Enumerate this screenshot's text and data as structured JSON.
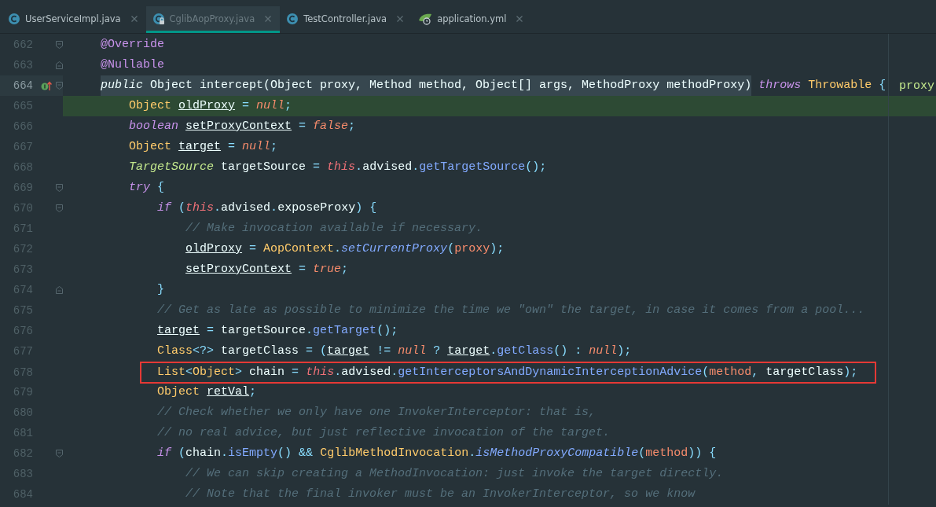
{
  "tabs": [
    {
      "label": "UserServiceImpl.java",
      "kind": "class",
      "selected": false,
      "locked": false
    },
    {
      "label": "CglibAopProxy.java",
      "kind": "class",
      "selected": true,
      "locked": true
    },
    {
      "label": "TestController.java",
      "kind": "class",
      "selected": false,
      "locked": false
    },
    {
      "label": "application.yml",
      "kind": "config",
      "selected": false,
      "locked": false
    }
  ],
  "lines": [
    {
      "number": "662",
      "fold_start": true,
      "tokens": [
        {
          "text": "    @Override",
          "kind": "annotation"
        }
      ]
    },
    {
      "number": "663",
      "fold_end": true,
      "tokens": [
        {
          "text": "    @Nullable",
          "kind": "annotation"
        }
      ]
    },
    {
      "number": "664",
      "fold_start": true,
      "current": true,
      "implements_marker": true,
      "inline_value": "proxy",
      "tokens": [
        {
          "text": "    public",
          "kind": "keyword",
          "selected": true
        },
        {
          "text": " Object intercept(Object proxy, Method method, Object[] args, MethodProxy methodProxy)",
          "selected": true
        },
        {
          "text": " throws",
          "kind": "keyword"
        },
        {
          "text": " Throwable",
          "kind": "type"
        },
        {
          "text": " {",
          "kind": "punct"
        }
      ]
    },
    {
      "number": "665",
      "execution": true,
      "tokens": [
        {
          "text": "        Object ",
          "kind": "type"
        },
        {
          "text": "oldProxy",
          "kind": "var"
        },
        {
          "text": " = ",
          "kind": "punct"
        },
        {
          "text": "null",
          "kind": "literal"
        },
        {
          "text": ";",
          "kind": "punct"
        }
      ]
    },
    {
      "number": "666",
      "tokens": [
        {
          "text": "        boolean ",
          "kind": "keyword"
        },
        {
          "text": "setProxyContext",
          "kind": "var"
        },
        {
          "text": " = ",
          "kind": "punct"
        },
        {
          "text": "false",
          "kind": "literal"
        },
        {
          "text": ";",
          "kind": "punct"
        }
      ]
    },
    {
      "number": "667",
      "tokens": [
        {
          "text": "        Object ",
          "kind": "type"
        },
        {
          "text": "target",
          "kind": "var"
        },
        {
          "text": " = ",
          "kind": "punct"
        },
        {
          "text": "null",
          "kind": "literal"
        },
        {
          "text": ";",
          "kind": "punct"
        }
      ]
    },
    {
      "number": "668",
      "tokens": [
        {
          "text": "        TargetSource",
          "kind": "interface"
        },
        {
          "text": " targetSource "
        },
        {
          "text": "= ",
          "kind": "punct"
        },
        {
          "text": "this",
          "kind": "this"
        },
        {
          "text": ".",
          "kind": "punct"
        },
        {
          "text": "advised"
        },
        {
          "text": ".",
          "kind": "punct"
        },
        {
          "text": "getTargetSource",
          "kind": "method"
        },
        {
          "text": "();",
          "kind": "punct"
        }
      ]
    },
    {
      "number": "669",
      "fold_start": true,
      "tokens": [
        {
          "text": "        try",
          "kind": "keyword"
        },
        {
          "text": " {",
          "kind": "punct"
        }
      ]
    },
    {
      "number": "670",
      "fold_start": true,
      "tokens": [
        {
          "text": "            if",
          "kind": "keyword"
        },
        {
          "text": " (",
          "kind": "punct"
        },
        {
          "text": "this",
          "kind": "this"
        },
        {
          "text": ".",
          "kind": "punct"
        },
        {
          "text": "advised"
        },
        {
          "text": ".",
          "kind": "punct"
        },
        {
          "text": "exposeProxy"
        },
        {
          "text": ") {",
          "kind": "punct"
        }
      ]
    },
    {
      "number": "671",
      "tokens": [
        {
          "text": "                // Make invocation available if necessary.",
          "kind": "comment"
        }
      ]
    },
    {
      "number": "672",
      "tokens": [
        {
          "text": "                oldProxy",
          "kind": "var"
        },
        {
          "text": " = ",
          "kind": "punct"
        },
        {
          "text": "AopContext",
          "kind": "type"
        },
        {
          "text": ".",
          "kind": "punct"
        },
        {
          "text": "setCurrentProxy",
          "kind": "static"
        },
        {
          "text": "(",
          "kind": "punct"
        },
        {
          "text": "proxy",
          "kind": "param"
        },
        {
          "text": ");",
          "kind": "punct"
        }
      ]
    },
    {
      "number": "673",
      "tokens": [
        {
          "text": "                setProxyContext",
          "kind": "var"
        },
        {
          "text": " = ",
          "kind": "punct"
        },
        {
          "text": "true",
          "kind": "literal"
        },
        {
          "text": ";",
          "kind": "punct"
        }
      ]
    },
    {
      "number": "674",
      "fold_end": true,
      "tokens": [
        {
          "text": "            }",
          "kind": "punct"
        }
      ]
    },
    {
      "number": "675",
      "tokens": [
        {
          "text": "            // Get as late as possible to minimize the time we \"own\" the target, in case it comes from a pool...",
          "kind": "comment"
        }
      ]
    },
    {
      "number": "676",
      "tokens": [
        {
          "text": "            target",
          "kind": "var"
        },
        {
          "text": " = ",
          "kind": "punct"
        },
        {
          "text": "targetSource"
        },
        {
          "text": ".",
          "kind": "punct"
        },
        {
          "text": "getTarget",
          "kind": "method"
        },
        {
          "text": "();",
          "kind": "punct"
        }
      ]
    },
    {
      "number": "677",
      "tokens": [
        {
          "text": "            Class",
          "kind": "type"
        },
        {
          "text": "<?>",
          "kind": "punct"
        },
        {
          "text": " targetClass "
        },
        {
          "text": "= (",
          "kind": "punct"
        },
        {
          "text": "target",
          "kind": "var"
        },
        {
          "text": " != ",
          "kind": "punct"
        },
        {
          "text": "null",
          "kind": "literal"
        },
        {
          "text": " ? ",
          "kind": "punct"
        },
        {
          "text": "target",
          "kind": "var"
        },
        {
          "text": ".",
          "kind": "punct"
        },
        {
          "text": "getClass",
          "kind": "method"
        },
        {
          "text": "() : ",
          "kind": "punct"
        },
        {
          "text": "null",
          "kind": "literal"
        },
        {
          "text": ");",
          "kind": "punct"
        }
      ]
    },
    {
      "number": "678",
      "boxed": true,
      "tokens": [
        {
          "text": "            List",
          "kind": "type"
        },
        {
          "text": "<",
          "kind": "punct"
        },
        {
          "text": "Object",
          "kind": "type"
        },
        {
          "text": ">",
          "kind": "punct"
        },
        {
          "text": " chain "
        },
        {
          "text": "= ",
          "kind": "punct"
        },
        {
          "text": "this",
          "kind": "this"
        },
        {
          "text": ".",
          "kind": "punct"
        },
        {
          "text": "advised"
        },
        {
          "text": ".",
          "kind": "punct"
        },
        {
          "text": "getInterceptorsAndDynamicInterceptionAdvice",
          "kind": "method"
        },
        {
          "text": "(",
          "kind": "punct"
        },
        {
          "text": "method",
          "kind": "param"
        },
        {
          "text": ", ",
          "kind": "punct"
        },
        {
          "text": "targetClass"
        },
        {
          "text": ");",
          "kind": "punct"
        }
      ]
    },
    {
      "number": "679",
      "tokens": [
        {
          "text": "            Object ",
          "kind": "type"
        },
        {
          "text": "retVal",
          "kind": "var"
        },
        {
          "text": ";",
          "kind": "punct"
        }
      ]
    },
    {
      "number": "680",
      "tokens": [
        {
          "text": "            // Check whether we only have one InvokerInterceptor: that is,",
          "kind": "comment"
        }
      ]
    },
    {
      "number": "681",
      "tokens": [
        {
          "text": "            // no real advice, but just reflective invocation of the target.",
          "kind": "comment"
        }
      ]
    },
    {
      "number": "682",
      "fold_start": true,
      "tokens": [
        {
          "text": "            if",
          "kind": "keyword"
        },
        {
          "text": " (",
          "kind": "punct"
        },
        {
          "text": "chain"
        },
        {
          "text": ".",
          "kind": "punct"
        },
        {
          "text": "isEmpty",
          "kind": "method"
        },
        {
          "text": "() && ",
          "kind": "punct"
        },
        {
          "text": "CglibMethodInvocation",
          "kind": "type"
        },
        {
          "text": ".",
          "kind": "punct"
        },
        {
          "text": "isMethodProxyCompatible",
          "kind": "static"
        },
        {
          "text": "(",
          "kind": "punct"
        },
        {
          "text": "method",
          "kind": "param"
        },
        {
          "text": ")) {",
          "kind": "punct"
        }
      ]
    },
    {
      "number": "683",
      "tokens": [
        {
          "text": "                // We can skip creating a MethodInvocation: just invoke the target directly.",
          "kind": "comment"
        }
      ]
    },
    {
      "number": "684",
      "tokens": [
        {
          "text": "                // Note that the final invoker must be an InvokerInterceptor, so we know",
          "kind": "comment"
        }
      ]
    }
  ]
}
